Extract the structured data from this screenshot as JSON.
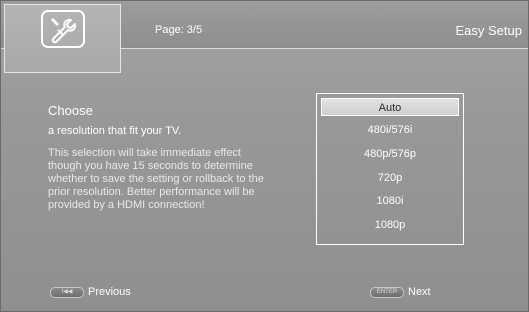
{
  "header": {
    "page_label": "Page: 3/5",
    "title": "Easy Setup",
    "logo_icon": "wrench-icon"
  },
  "main": {
    "heading": "Choose",
    "subtitle": "a resolution that fit your TV.",
    "description_lines": [
      "This selection will take immediate effect",
      "though you have 15 seconds to determine",
      "whether to save the setting or rollback to the",
      "prior resolution. Better performance will be",
      "provided by a HDMI connection!"
    ]
  },
  "options": {
    "items": [
      "Auto",
      "480i/576i",
      "480p/576p",
      "720p",
      "1080i",
      "1080p"
    ],
    "selected": "Auto"
  },
  "footer": {
    "previous_label": "Previous",
    "previous_key": "I◀◀",
    "next_label": "Next",
    "next_key": "ENTER"
  },
  "colors": {
    "background": "#989898",
    "text": "#ffffff",
    "highlight": "#d8d8d8"
  }
}
